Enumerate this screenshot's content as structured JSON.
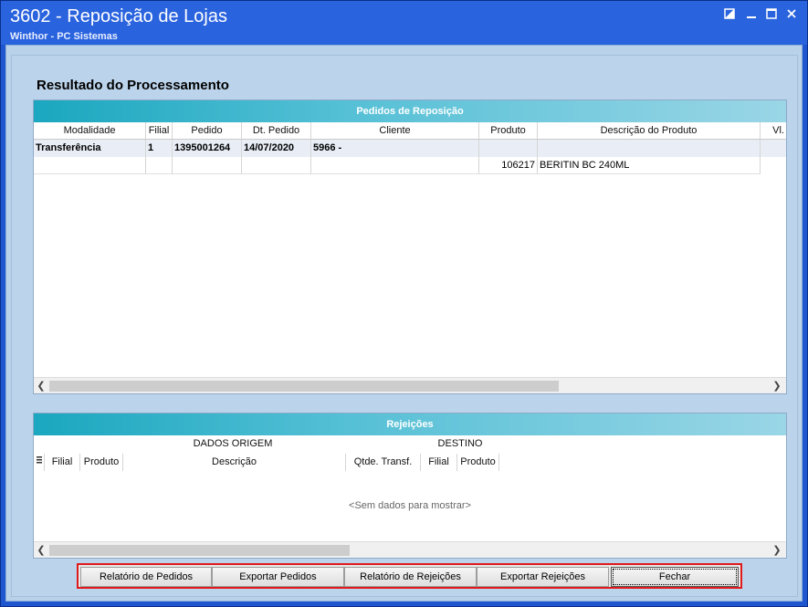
{
  "window": {
    "title": "3602 - Reposição de Lojas",
    "subtitle": "Winthor - PC Sistemas",
    "controls": [
      "restore-icon",
      "minimize-icon",
      "maximize-icon",
      "close-icon"
    ]
  },
  "main": {
    "heading": "Resultado do Processamento"
  },
  "pedidos": {
    "title": "Pedidos de Reposição",
    "columns": [
      "Modalidade",
      "Filial",
      "Pedido",
      "Dt. Pedido",
      "Cliente",
      "Produto",
      "Descrição do Produto",
      "Vl."
    ],
    "master_row": {
      "modalidade": "Transferência",
      "filial": "1",
      "pedido": "1395001264",
      "dt_pedido": "14/07/2020",
      "cliente": "5966 -"
    },
    "detail_row": {
      "produto": "106217",
      "descricao": "BERITIN BC 240ML"
    }
  },
  "rejeicoes": {
    "title": "Rejeições",
    "band_origem": "DADOS ORIGEM",
    "band_destino": "DESTINO",
    "columns": [
      "Filial",
      "Produto",
      "Descrição",
      "Qtde. Transf.",
      "Filial",
      "Produto"
    ],
    "empty_text": "<Sem dados para mostrar>"
  },
  "buttons": {
    "relatorio_pedidos": "Relatório de Pedidos",
    "exportar_pedidos": "Exportar Pedidos",
    "relatorio_rejeicoes": "Relatório de Rejeições",
    "exportar_rejeicoes": "Exportar Rejeições",
    "fechar": "Fechar"
  },
  "colors": {
    "title_bar": "#2a63de",
    "panel_header": "#1aa7bf",
    "highlight_border": "#e01a1a"
  }
}
